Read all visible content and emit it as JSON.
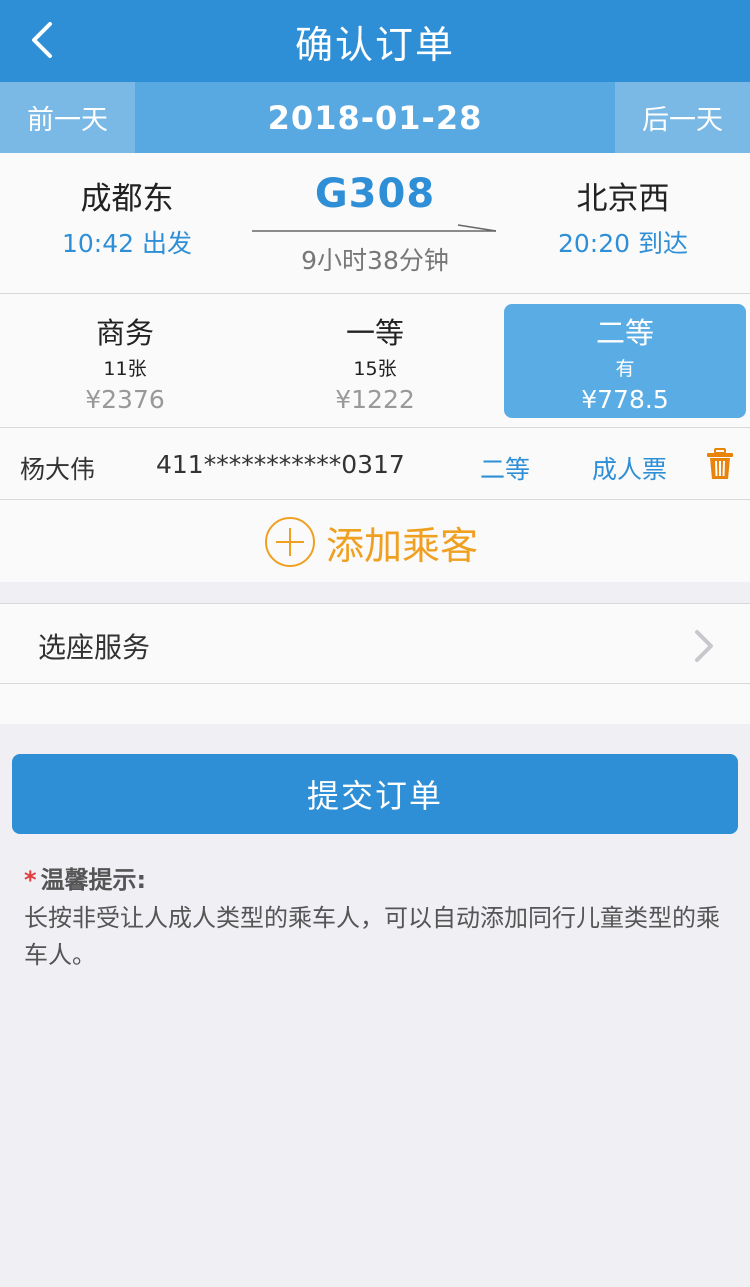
{
  "header": {
    "title": "确认订单"
  },
  "date_bar": {
    "prev_label": "前一天",
    "date": "2018-01-28",
    "next_label": "后一天"
  },
  "trip": {
    "from_station": "成都东",
    "depart_time": "10:42 出发",
    "train_no": "G308",
    "duration": "9小时38分钟",
    "to_station": "北京西",
    "arrive_time": "20:20 到达"
  },
  "seats": [
    {
      "name": "商务",
      "count": "11张",
      "price": "¥2376",
      "selected": false
    },
    {
      "name": "一等",
      "count": "15张",
      "price": "¥1222",
      "selected": false
    },
    {
      "name": "二等",
      "count": "有",
      "price": "¥778.5",
      "selected": true
    }
  ],
  "passenger": {
    "name": "杨大伟",
    "id_number": "411***********0317",
    "seat_class": "二等",
    "ticket_type": "成人票"
  },
  "add_passenger": {
    "label": "添加乘客"
  },
  "service": {
    "label": "选座服务"
  },
  "submit": {
    "label": "提交订单"
  },
  "tips": {
    "star": "*",
    "title": "温馨提示:",
    "text": "长按非受让人成人类型的乘车人，可以自动添加同行儿童类型的乘车人。"
  },
  "colors": {
    "primary": "#2e8fd6",
    "date_bar": "#58a9e2",
    "selected_seat": "#5aace4",
    "accent_orange": "#f0a020",
    "background": "#efeff4"
  },
  "icons": [
    "back-icon",
    "arrow-icon",
    "trash-icon",
    "plus-icon",
    "chevron-right-icon"
  ]
}
